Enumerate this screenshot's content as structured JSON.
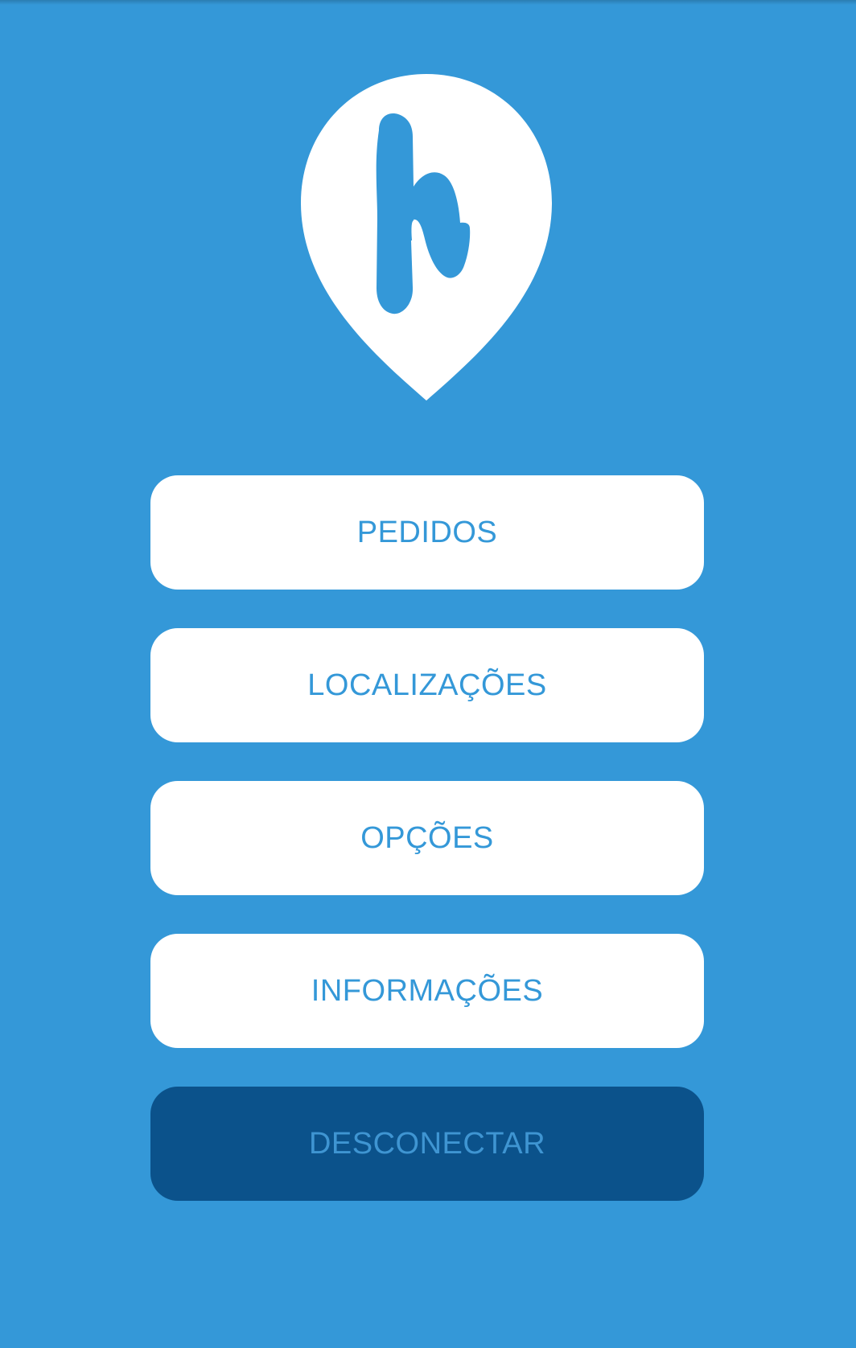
{
  "colors": {
    "background": "#3498d8",
    "button_background": "#ffffff",
    "button_text": "#3498d8",
    "logout_background": "#0b528b",
    "logout_text": "#3f95d2"
  },
  "logo": {
    "icon": "location-pin-h-logo-icon",
    "letter": "h"
  },
  "menu": {
    "items": [
      {
        "label": "PEDIDOS"
      },
      {
        "label": "LOCALIZAÇÕES"
      },
      {
        "label": "OPÇÕES"
      },
      {
        "label": "INFORMAÇÕES"
      }
    ],
    "logout_label": "DESCONECTAR"
  }
}
